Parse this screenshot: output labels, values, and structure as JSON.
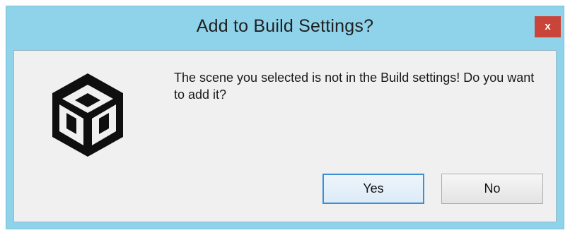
{
  "dialog": {
    "title": "Add to Build Settings?",
    "close_label": "x",
    "message": "The scene you selected is not in the Build settings! Do you want to add it?",
    "icon": "unity-logo-icon",
    "buttons": {
      "yes_label": "Yes",
      "no_label": "No"
    }
  },
  "colors": {
    "titlebar": "#8fd3ea",
    "close": "#c9453a",
    "client": "#f0f0f0",
    "default_button_border": "#3c8fd6"
  }
}
